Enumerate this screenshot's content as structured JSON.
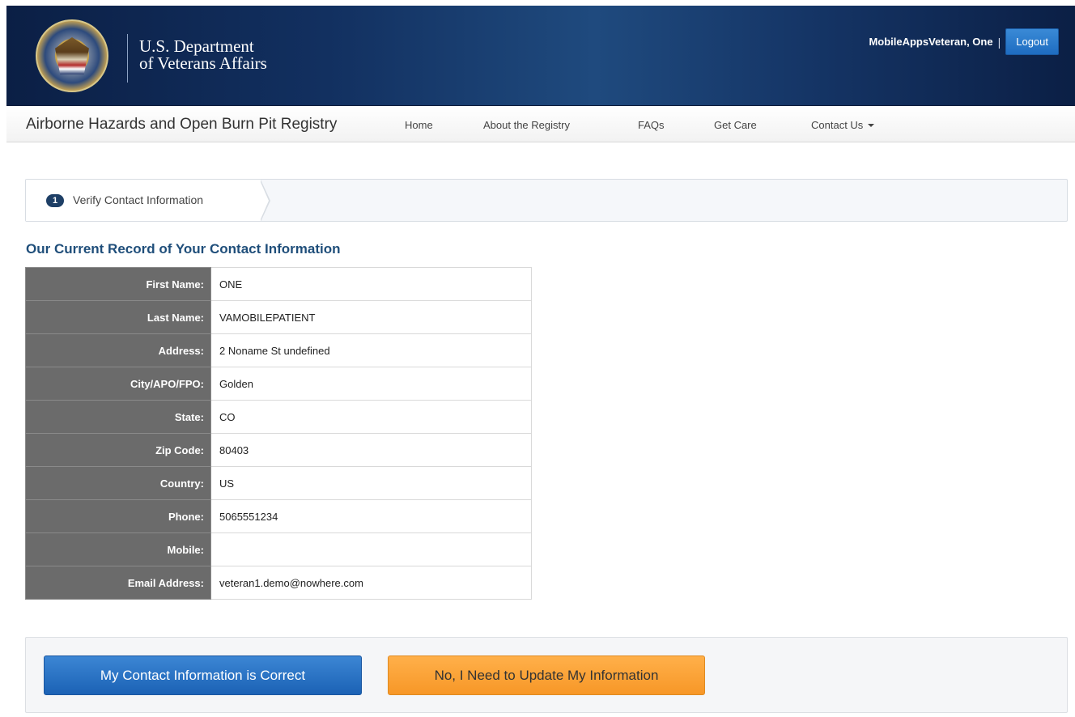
{
  "header": {
    "dept_line1": "U.S. Department",
    "dept_line2": "of Veterans Affairs",
    "user_name": "MobileAppsVeteran, One",
    "separator": "|",
    "logout_label": "Logout"
  },
  "nav": {
    "brand": "Airborne Hazards and Open Burn Pit Registry",
    "items": [
      {
        "label": "Home"
      },
      {
        "label": "About the Registry"
      },
      {
        "label": "FAQs"
      },
      {
        "label": "Get Care"
      },
      {
        "label": "Contact Us"
      }
    ]
  },
  "steps": {
    "active_number": "1",
    "active_label": "Verify Contact Information"
  },
  "contact": {
    "title": "Our Current Record of Your Contact Information",
    "rows": [
      {
        "label": "First Name:",
        "value": "ONE"
      },
      {
        "label": "Last Name:",
        "value": "VAMOBILEPATIENT"
      },
      {
        "label": "Address:",
        "value": "2 Noname St undefined"
      },
      {
        "label": "City/APO/FPO:",
        "value": "Golden"
      },
      {
        "label": "State:",
        "value": "CO"
      },
      {
        "label": "Zip Code:",
        "value": "80403"
      },
      {
        "label": "Country:",
        "value": "US"
      },
      {
        "label": "Phone:",
        "value": "5065551234"
      },
      {
        "label": "Mobile:",
        "value": ""
      },
      {
        "label": "Email Address:",
        "value": "veteran1.demo@nowhere.com"
      }
    ]
  },
  "actions": {
    "confirm_label": "My Contact Information is Correct",
    "update_label": "No, I Need to Update My Information"
  },
  "colors": {
    "header_bg": "#123060",
    "primary_button": "#1b62b5",
    "warning_button": "#f79727",
    "label_cell_bg": "#6b6b6b",
    "section_title": "#1f4e7a"
  },
  "icons": [
    "va-seal-logo",
    "caret-down-icon"
  ]
}
